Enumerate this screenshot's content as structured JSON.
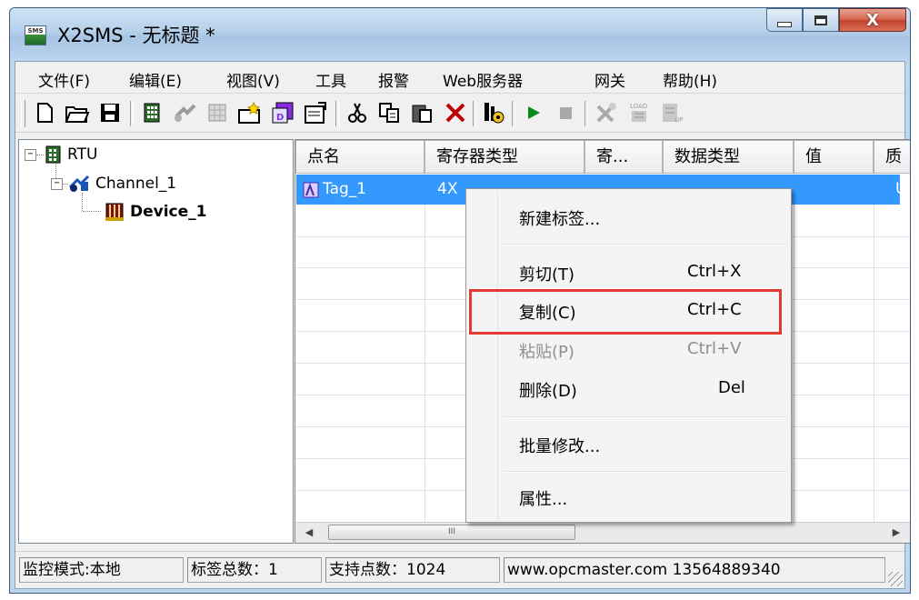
{
  "window": {
    "title": "X2SMS - 无标题 *",
    "icon_label": "SMS",
    "buttons": [
      "minimize",
      "maximize",
      "close"
    ],
    "close_glyph": "X"
  },
  "menubar": {
    "items": [
      "文件(F)",
      "编辑(E)",
      "视图(V)",
      "工具",
      "报警",
      "Web服务器",
      "网关",
      "帮助(H)"
    ]
  },
  "toolbar": {
    "icons": [
      "new-file-icon",
      "open-folder-icon",
      "save-icon",
      "add-rtu-icon",
      "add-channel-icon",
      "add-device-icon",
      "new-tag-icon",
      "batch-tag-icon",
      "properties-icon",
      "cut-icon",
      "copy-icon",
      "paste-icon",
      "delete-icon",
      "run-settings-icon",
      "start-icon",
      "stop-icon",
      "tools-icon",
      "load-icon",
      "upload-icon"
    ],
    "load_text": "LOAD",
    "up_text": "UP"
  },
  "tree": {
    "nodes": [
      {
        "label": "RTU",
        "level": 0,
        "expander": "−",
        "icon": "rtu-icon"
      },
      {
        "label": "Channel_1",
        "level": 1,
        "expander": "−",
        "icon": "channel-icon"
      },
      {
        "label": "Device_1",
        "level": 2,
        "icon": "device-icon",
        "bold": true
      }
    ]
  },
  "list": {
    "columns": [
      "点名",
      "寄存器类型",
      "寄...",
      "数据类型",
      "值",
      "质"
    ],
    "rows": [
      {
        "name": "Tag_1",
        "register_type": "4X",
        "quality": "U",
        "selected": true
      }
    ]
  },
  "context_menu": {
    "items": [
      {
        "label": "新建标签...",
        "shortcut": "",
        "enabled": true
      },
      {
        "label": "剪切(T)",
        "shortcut": "Ctrl+X",
        "enabled": true
      },
      {
        "label": "复制(C)",
        "shortcut": "Ctrl+C",
        "enabled": true,
        "highlighted": true
      },
      {
        "label": "粘贴(P)",
        "shortcut": "Ctrl+V",
        "enabled": false
      },
      {
        "label": "删除(D)",
        "shortcut": "Del",
        "enabled": true
      },
      {
        "label": "批量修改...",
        "shortcut": "",
        "enabled": true
      },
      {
        "label": "属性...",
        "shortcut": "",
        "enabled": true
      }
    ],
    "highlight_color": "#e53935"
  },
  "scrollbar": {
    "thumb_grip": "III",
    "left_arrow": "◀",
    "right_arrow": "▶"
  },
  "statusbar": {
    "panes": [
      "监控模式:本地",
      "标签总数：1",
      "支持点数：1024",
      "www.opcmaster.com 13564889340"
    ]
  },
  "colors": {
    "selection": "#3399ff",
    "title_gradient": "#b5d0ea",
    "close_button": "#c2442b"
  }
}
